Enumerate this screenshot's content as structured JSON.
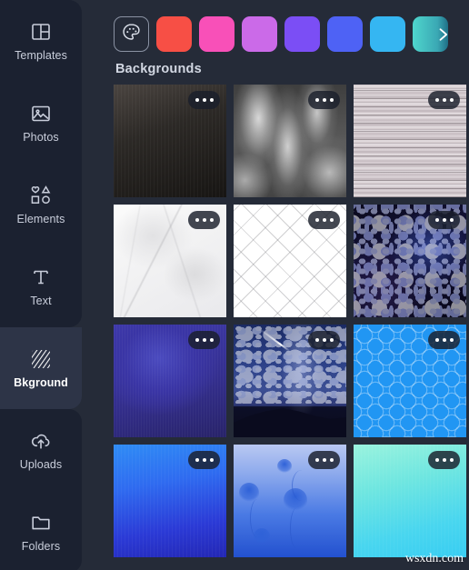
{
  "sidebar": {
    "items": [
      {
        "label": "Templates",
        "icon": "templates-icon",
        "active": false
      },
      {
        "label": "Photos",
        "icon": "photo-icon",
        "active": false
      },
      {
        "label": "Elements",
        "icon": "shapes-icon",
        "active": false
      },
      {
        "label": "Text",
        "icon": "text-icon",
        "active": false
      },
      {
        "label": "Bkground",
        "icon": "hatch-icon",
        "active": true
      },
      {
        "label": "Uploads",
        "icon": "upload-cloud-icon",
        "active": false
      },
      {
        "label": "Folders",
        "icon": "folder-icon",
        "active": false
      }
    ]
  },
  "palette": {
    "button_icon": "color-palette-icon",
    "next_icon": "chevron-right-icon",
    "swatches": [
      {
        "name": "red",
        "color": "#f74f45"
      },
      {
        "name": "pink",
        "color": "#f850b8"
      },
      {
        "name": "orchid",
        "color": "#cb6ae8"
      },
      {
        "name": "violet",
        "color": "#7b4ef5"
      },
      {
        "name": "blue",
        "color": "#4e62f5"
      },
      {
        "name": "cyan",
        "color": "#35b6f2"
      },
      {
        "name": "teal",
        "color": "#4fd6cd"
      }
    ]
  },
  "section": {
    "title": "Backgrounds"
  },
  "grid": {
    "menu_label": "...",
    "thumbnails": [
      {
        "name": "dark-gradient",
        "art": "bg-dark-grad"
      },
      {
        "name": "grey-smoke",
        "art": "bg-smoke"
      },
      {
        "name": "white-wood",
        "art": "bg-wood"
      },
      {
        "name": "white-marble",
        "art": "bg-marble"
      },
      {
        "name": "white-crosshatch",
        "art": "bg-grid"
      },
      {
        "name": "deep-space",
        "art": "bg-space"
      },
      {
        "name": "indigo-solid",
        "art": "bg-indigo"
      },
      {
        "name": "starry-night",
        "art": "bg-night"
      },
      {
        "name": "blue-hexagons",
        "art": "bg-hex"
      },
      {
        "name": "blue-gradient",
        "art": "bg-bluegrad"
      },
      {
        "name": "jellyfish",
        "art": "bg-jelly"
      },
      {
        "name": "mint-gradient",
        "art": "bg-mint"
      }
    ]
  },
  "watermark": {
    "text": "wsxdn.com"
  }
}
